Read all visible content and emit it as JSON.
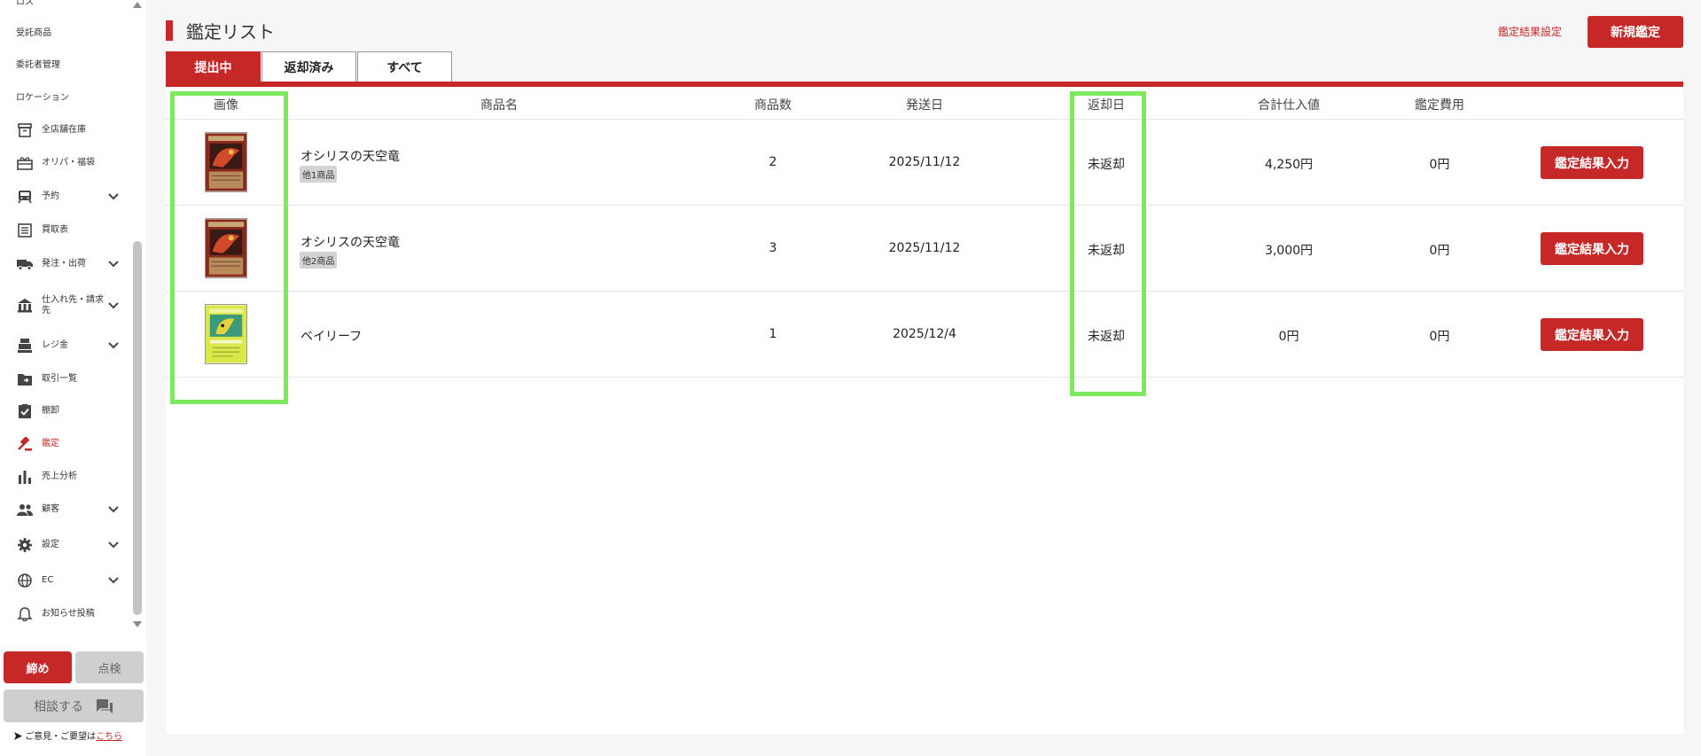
{
  "sidebar": {
    "items": [
      {
        "label": "ロス",
        "icon": "none",
        "chevron": false
      },
      {
        "label": "受託商品",
        "icon": "none",
        "chevron": false
      },
      {
        "label": "委託者管理",
        "icon": "none",
        "chevron": false
      },
      {
        "label": "ロケーション",
        "icon": "none",
        "chevron": false
      },
      {
        "label": "全店舗在庫",
        "icon": "archive-icon",
        "chevron": false
      },
      {
        "label": "オリパ・福袋",
        "icon": "gift-icon",
        "chevron": false
      },
      {
        "label": "予約",
        "icon": "train-icon",
        "chevron": true
      },
      {
        "label": "買取表",
        "icon": "list-icon",
        "chevron": false
      },
      {
        "label": "発注・出荷",
        "icon": "truck-icon",
        "chevron": true
      },
      {
        "label": "仕入れ先・請求先",
        "icon": "bank-icon",
        "chevron": true
      },
      {
        "label": "レジ金",
        "icon": "register-icon",
        "chevron": true
      },
      {
        "label": "取引一覧",
        "icon": "folder-icon",
        "chevron": false
      },
      {
        "label": "棚卸",
        "icon": "clipboard-check-icon",
        "chevron": false
      },
      {
        "label": "鑑定",
        "icon": "gavel-icon",
        "chevron": false,
        "active": true
      },
      {
        "label": "売上分析",
        "icon": "bar-chart-icon",
        "chevron": false
      },
      {
        "label": "顧客",
        "icon": "people-icon",
        "chevron": true
      },
      {
        "label": "設定",
        "icon": "gear-icon",
        "chevron": true
      },
      {
        "label": "EC",
        "icon": "globe-icon",
        "chevron": true
      },
      {
        "label": "お知らせ投稿",
        "icon": "bell-icon",
        "chevron": false
      }
    ],
    "close_day_label": "締め",
    "check_label": "点検",
    "consult_label": "相談する",
    "feedback_text": "ご意見・ご要望は",
    "feedback_link": "こちら"
  },
  "header": {
    "title": "鑑定リスト",
    "settings_link": "鑑定結果設定",
    "new_button": "新規鑑定"
  },
  "tabs": [
    {
      "label": "提出中",
      "active": true
    },
    {
      "label": "返却済み",
      "active": false
    },
    {
      "label": "すべて",
      "active": false
    }
  ],
  "table": {
    "columns": [
      "画像",
      "商品名",
      "商品数",
      "発送日",
      "返却日",
      "合計仕入値",
      "鑑定費用"
    ],
    "rows": [
      {
        "name": "オシリスの天空竜",
        "badge": "他1商品",
        "count": "2",
        "ship_date": "2025/11/12",
        "return_date": "未返却",
        "total_cost": "4,250円",
        "fee": "0円",
        "action": "鑑定結果入力",
        "card": "red"
      },
      {
        "name": "オシリスの天空竜",
        "badge": "他2商品",
        "count": "3",
        "ship_date": "2025/11/12",
        "return_date": "未返却",
        "total_cost": "3,000円",
        "fee": "0円",
        "action": "鑑定結果入力",
        "card": "red"
      },
      {
        "name": "ベイリーフ",
        "badge": "",
        "count": "1",
        "ship_date": "2025/12/4",
        "return_date": "未返却",
        "total_cost": "0円",
        "fee": "0円",
        "action": "鑑定結果入力",
        "card": "green"
      }
    ]
  },
  "colors": {
    "accent": "#c62828",
    "highlight": "#7ee85e"
  }
}
